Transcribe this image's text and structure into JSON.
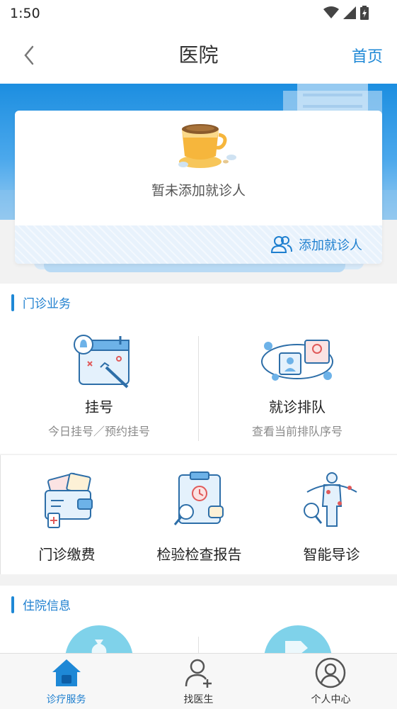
{
  "status": {
    "time": "1:50"
  },
  "nav": {
    "title": "医院",
    "home": "首页"
  },
  "patient_card": {
    "empty_text": "暂未添加就诊人",
    "add_label": "添加就诊人"
  },
  "outpatient": {
    "section_title": "门诊业务",
    "register": {
      "title": "挂号",
      "subtitle": "今日挂号／预约挂号"
    },
    "queue": {
      "title": "就诊排队",
      "subtitle": "查看当前排队序号"
    },
    "payment": {
      "title": "门诊缴费"
    },
    "report": {
      "title": "检验检查报告"
    },
    "guide": {
      "title": "智能导诊"
    }
  },
  "inpatient": {
    "section_title": "住院信息"
  },
  "tabs": [
    {
      "label": "诊疗服务",
      "active": true,
      "icon": "home-icon"
    },
    {
      "label": "找医生",
      "active": false,
      "icon": "add-person-icon"
    },
    {
      "label": "个人中心",
      "active": false,
      "icon": "user-circle-icon"
    }
  ],
  "colors": {
    "accent": "#1e88d6",
    "banner": "#1c8ee0"
  }
}
